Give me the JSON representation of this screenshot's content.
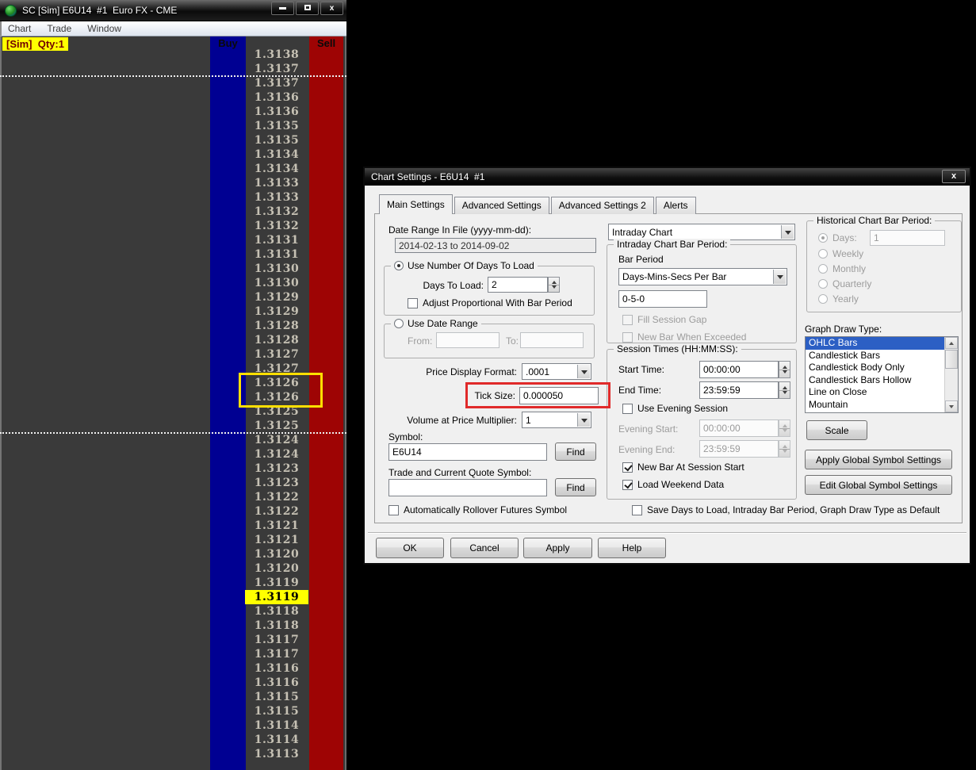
{
  "window": {
    "title": "SC [Sim] E6U14  #1  Euro FX - CME",
    "menu": [
      "Chart",
      "Trade",
      "Window"
    ],
    "sim_qty_label": "[Sim]  Qty:1",
    "controls": {
      "close_glyph": "x"
    },
    "ladder": {
      "buy_header": "Buy",
      "sell_header": "Sell",
      "prices": [
        "1.3138",
        "1.3137",
        "1.3137",
        "1.3136",
        "1.3136",
        "1.3135",
        "1.3135",
        "1.3134",
        "1.3134",
        "1.3133",
        "1.3133",
        "1.3132",
        "1.3132",
        "1.3131",
        "1.3131",
        "1.3130",
        "1.3130",
        "1.3129",
        "1.3129",
        "1.3128",
        "1.3128",
        "1.3127",
        "1.3127",
        "1.3126",
        "1.3126",
        "1.3125",
        "1.3125",
        "1.3124",
        "1.3124",
        "1.3123",
        "1.3123",
        "1.3122",
        "1.3122",
        "1.3121",
        "1.3121",
        "1.3120",
        "1.3120",
        "1.3119",
        "1.3119",
        "1.3118",
        "1.3118",
        "1.3117",
        "1.3117",
        "1.3116",
        "1.3116",
        "1.3115",
        "1.3115",
        "1.3114",
        "1.3114",
        "1.3113"
      ],
      "highlight_index": 38,
      "highlighted_price": "1.3119",
      "boxed_indices": [
        23,
        24
      ],
      "dotted_after": [
        1,
        26
      ]
    },
    "colors": {
      "buy_column": "#000092",
      "sell_column": "#9e0404",
      "chart_bg": "#3a3a3a",
      "highlight_bg": "#ffff00"
    }
  },
  "annotations": {
    "yellow_box_color": "#ffdf00",
    "red_box_color": "#e02a2a"
  },
  "dialog": {
    "title": "Chart Settings - E6U14  #1",
    "close_glyph": "x",
    "tabs": [
      "Main Settings",
      "Advanced Settings",
      "Advanced Settings 2",
      "Alerts"
    ],
    "active_tab": "Main Settings",
    "fields": {
      "date_range_label": "Date Range In File (yyyy-mm-dd):",
      "date_range_value": "2014-02-13 to 2014-09-02",
      "use_days_group": "Use Number Of Days To Load",
      "days_to_load_label": "Days To Load:",
      "days_to_load_value": "2",
      "adjust_proportional_label": "Adjust Proportional With Bar Period",
      "use_date_range_group": "Use Date Range",
      "from_label": "From:",
      "from_value": "",
      "to_label": "To:",
      "to_value": "",
      "price_display_format_label": "Price Display Format:",
      "price_display_format_value": ".0001",
      "tick_size_label": "Tick Size:",
      "tick_size_value": "0.000050",
      "volume_multiplier_label": "Volume at Price Multiplier:",
      "volume_multiplier_value": "1",
      "symbol_label": "Symbol:",
      "symbol_value": "E6U14",
      "find_label": "Find",
      "trade_symbol_label": "Trade and Current Quote Symbol:",
      "trade_symbol_value": "",
      "auto_rollover_label": "Automatically Rollover Futures Symbol",
      "chart_type_value": "Intraday Chart",
      "intraday_group": "Intraday Chart Bar Period:",
      "bar_period_label": "Bar Period",
      "bar_period_value": "Days-Mins-Secs Per Bar",
      "bar_period_custom_value": "0-5-0",
      "fill_session_gap_label": "Fill Session Gap",
      "new_bar_exceeded_label": "New Bar When Exceeded",
      "session_times_group": "Session Times (HH:MM:SS):",
      "start_time_label": "Start Time:",
      "start_time_value": "00:00:00",
      "end_time_label": "End Time:",
      "end_time_value": "23:59:59",
      "use_evening_label": "Use Evening Session",
      "evening_start_label": "Evening Start:",
      "evening_start_value": "00:00:00",
      "evening_end_label": "Evening End:",
      "evening_end_value": "23:59:59",
      "new_bar_session_label": "New Bar At Session Start",
      "load_weekend_label": "Load Weekend Data",
      "historical_group": "Historical Chart Bar Period:",
      "days_label": "Days:",
      "days_value": "1",
      "weekly_label": "Weekly",
      "monthly_label": "Monthly",
      "quarterly_label": "Quarterly",
      "yearly_label": "Yearly",
      "graph_draw_type_label": "Graph Draw Type:",
      "graph_draw_types": [
        "OHLC Bars",
        "Candlestick Bars",
        "Candlestick Body Only",
        "Candlestick Bars Hollow",
        "Line on Close",
        "Mountain"
      ],
      "graph_draw_type_selected": "OHLC Bars",
      "scale_button": "Scale",
      "apply_global_button": "Apply Global Symbol Settings",
      "edit_global_button": "Edit Global Symbol Settings",
      "save_defaults_label": "Save Days to Load, Intraday Bar Period, Graph Draw Type as Default"
    },
    "buttons": {
      "ok": "OK",
      "cancel": "Cancel",
      "apply": "Apply",
      "help": "Help"
    }
  }
}
